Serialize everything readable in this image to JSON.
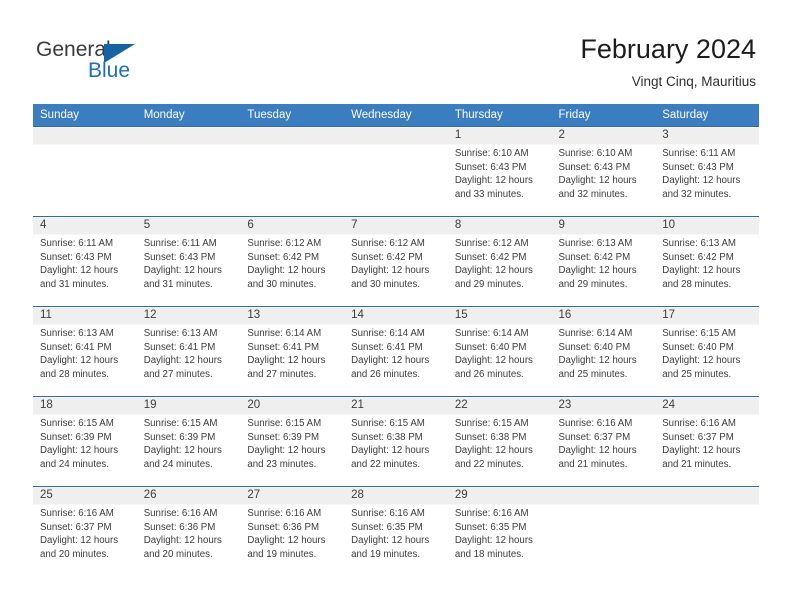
{
  "logo": {
    "word_one": "General",
    "word_two": "Blue",
    "triangle_color": "#1464a5",
    "blue_color": "#1c6fc0"
  },
  "header": {
    "title": "February 2024",
    "subtitle": "Vingt Cinq, Mauritius"
  },
  "theme": {
    "header_row_bg": "#3a7dc0",
    "row_divider": "#2d6ca8",
    "daynum_band": "#efefef",
    "text": "#3d3d3d"
  },
  "calendar": {
    "weekday_headers": [
      "Sunday",
      "Monday",
      "Tuesday",
      "Wednesday",
      "Thursday",
      "Friday",
      "Saturday"
    ],
    "labels": {
      "sunrise": "Sunrise:",
      "sunset": "Sunset:",
      "daylight": "Daylight:"
    },
    "weeks": [
      [
        {
          "day": ""
        },
        {
          "day": ""
        },
        {
          "day": ""
        },
        {
          "day": ""
        },
        {
          "day": "1",
          "l1": "Sunrise: 6:10 AM",
          "l2": "Sunset: 6:43 PM",
          "l3": "Daylight: 12 hours",
          "l4": "and 33 minutes."
        },
        {
          "day": "2",
          "l1": "Sunrise: 6:10 AM",
          "l2": "Sunset: 6:43 PM",
          "l3": "Daylight: 12 hours",
          "l4": "and 32 minutes."
        },
        {
          "day": "3",
          "l1": "Sunrise: 6:11 AM",
          "l2": "Sunset: 6:43 PM",
          "l3": "Daylight: 12 hours",
          "l4": "and 32 minutes."
        }
      ],
      [
        {
          "day": "4",
          "l1": "Sunrise: 6:11 AM",
          "l2": "Sunset: 6:43 PM",
          "l3": "Daylight: 12 hours",
          "l4": "and 31 minutes."
        },
        {
          "day": "5",
          "l1": "Sunrise: 6:11 AM",
          "l2": "Sunset: 6:43 PM",
          "l3": "Daylight: 12 hours",
          "l4": "and 31 minutes."
        },
        {
          "day": "6",
          "l1": "Sunrise: 6:12 AM",
          "l2": "Sunset: 6:42 PM",
          "l3": "Daylight: 12 hours",
          "l4": "and 30 minutes."
        },
        {
          "day": "7",
          "l1": "Sunrise: 6:12 AM",
          "l2": "Sunset: 6:42 PM",
          "l3": "Daylight: 12 hours",
          "l4": "and 30 minutes."
        },
        {
          "day": "8",
          "l1": "Sunrise: 6:12 AM",
          "l2": "Sunset: 6:42 PM",
          "l3": "Daylight: 12 hours",
          "l4": "and 29 minutes."
        },
        {
          "day": "9",
          "l1": "Sunrise: 6:13 AM",
          "l2": "Sunset: 6:42 PM",
          "l3": "Daylight: 12 hours",
          "l4": "and 29 minutes."
        },
        {
          "day": "10",
          "l1": "Sunrise: 6:13 AM",
          "l2": "Sunset: 6:42 PM",
          "l3": "Daylight: 12 hours",
          "l4": "and 28 minutes."
        }
      ],
      [
        {
          "day": "11",
          "l1": "Sunrise: 6:13 AM",
          "l2": "Sunset: 6:41 PM",
          "l3": "Daylight: 12 hours",
          "l4": "and 28 minutes."
        },
        {
          "day": "12",
          "l1": "Sunrise: 6:13 AM",
          "l2": "Sunset: 6:41 PM",
          "l3": "Daylight: 12 hours",
          "l4": "and 27 minutes."
        },
        {
          "day": "13",
          "l1": "Sunrise: 6:14 AM",
          "l2": "Sunset: 6:41 PM",
          "l3": "Daylight: 12 hours",
          "l4": "and 27 minutes."
        },
        {
          "day": "14",
          "l1": "Sunrise: 6:14 AM",
          "l2": "Sunset: 6:41 PM",
          "l3": "Daylight: 12 hours",
          "l4": "and 26 minutes."
        },
        {
          "day": "15",
          "l1": "Sunrise: 6:14 AM",
          "l2": "Sunset: 6:40 PM",
          "l3": "Daylight: 12 hours",
          "l4": "and 26 minutes."
        },
        {
          "day": "16",
          "l1": "Sunrise: 6:14 AM",
          "l2": "Sunset: 6:40 PM",
          "l3": "Daylight: 12 hours",
          "l4": "and 25 minutes."
        },
        {
          "day": "17",
          "l1": "Sunrise: 6:15 AM",
          "l2": "Sunset: 6:40 PM",
          "l3": "Daylight: 12 hours",
          "l4": "and 25 minutes."
        }
      ],
      [
        {
          "day": "18",
          "l1": "Sunrise: 6:15 AM",
          "l2": "Sunset: 6:39 PM",
          "l3": "Daylight: 12 hours",
          "l4": "and 24 minutes."
        },
        {
          "day": "19",
          "l1": "Sunrise: 6:15 AM",
          "l2": "Sunset: 6:39 PM",
          "l3": "Daylight: 12 hours",
          "l4": "and 24 minutes."
        },
        {
          "day": "20",
          "l1": "Sunrise: 6:15 AM",
          "l2": "Sunset: 6:39 PM",
          "l3": "Daylight: 12 hours",
          "l4": "and 23 minutes."
        },
        {
          "day": "21",
          "l1": "Sunrise: 6:15 AM",
          "l2": "Sunset: 6:38 PM",
          "l3": "Daylight: 12 hours",
          "l4": "and 22 minutes."
        },
        {
          "day": "22",
          "l1": "Sunrise: 6:15 AM",
          "l2": "Sunset: 6:38 PM",
          "l3": "Daylight: 12 hours",
          "l4": "and 22 minutes."
        },
        {
          "day": "23",
          "l1": "Sunrise: 6:16 AM",
          "l2": "Sunset: 6:37 PM",
          "l3": "Daylight: 12 hours",
          "l4": "and 21 minutes."
        },
        {
          "day": "24",
          "l1": "Sunrise: 6:16 AM",
          "l2": "Sunset: 6:37 PM",
          "l3": "Daylight: 12 hours",
          "l4": "and 21 minutes."
        }
      ],
      [
        {
          "day": "25",
          "l1": "Sunrise: 6:16 AM",
          "l2": "Sunset: 6:37 PM",
          "l3": "Daylight: 12 hours",
          "l4": "and 20 minutes."
        },
        {
          "day": "26",
          "l1": "Sunrise: 6:16 AM",
          "l2": "Sunset: 6:36 PM",
          "l3": "Daylight: 12 hours",
          "l4": "and 20 minutes."
        },
        {
          "day": "27",
          "l1": "Sunrise: 6:16 AM",
          "l2": "Sunset: 6:36 PM",
          "l3": "Daylight: 12 hours",
          "l4": "and 19 minutes."
        },
        {
          "day": "28",
          "l1": "Sunrise: 6:16 AM",
          "l2": "Sunset: 6:35 PM",
          "l3": "Daylight: 12 hours",
          "l4": "and 19 minutes."
        },
        {
          "day": "29",
          "l1": "Sunrise: 6:16 AM",
          "l2": "Sunset: 6:35 PM",
          "l3": "Daylight: 12 hours",
          "l4": "and 18 minutes."
        },
        {
          "day": ""
        },
        {
          "day": ""
        }
      ]
    ]
  }
}
